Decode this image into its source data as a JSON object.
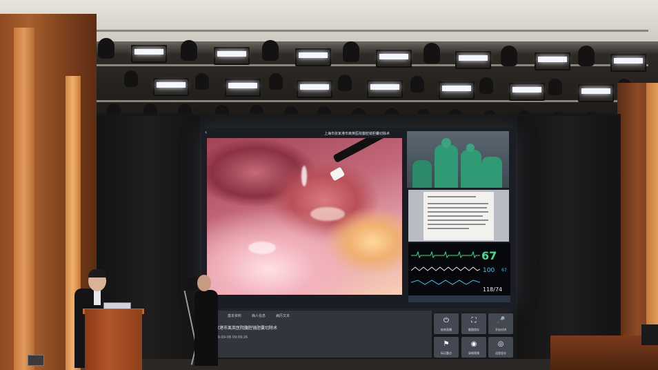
{
  "screen": {
    "title": "上海市张家港市离英医院腹腔镜胆囊切除术",
    "back_icon": "chevron-left-icon"
  },
  "tabs": [
    "基本资料",
    "病人信息",
    "病历文本"
  ],
  "case": {
    "title": "张家港市离英医院腹腔镜胆囊切除术",
    "time": "2019-09-08 09:09:26"
  },
  "monitor": {
    "heart_rate": "67",
    "spo2": "100",
    "pulse": "67",
    "bp": "118/74",
    "colors": {
      "hr": "#37e08a",
      "spo2": "#35c8f0"
    }
  },
  "controls": [
    {
      "icon": "power-icon",
      "glyph": "⏻",
      "label": "结束直播"
    },
    {
      "icon": "screenshot-icon",
      "glyph": "⛶",
      "label": "截图保存"
    },
    {
      "icon": "mic-icon",
      "glyph": "🎤",
      "label": "开启对讲"
    },
    {
      "icon": "flag-icon",
      "glyph": "⚑",
      "label": "标记重点"
    },
    {
      "icon": "record-icon",
      "glyph": "◉",
      "label": "录制视频"
    },
    {
      "icon": "video-call-icon",
      "glyph": "◎",
      "label": "远程会诊"
    }
  ]
}
